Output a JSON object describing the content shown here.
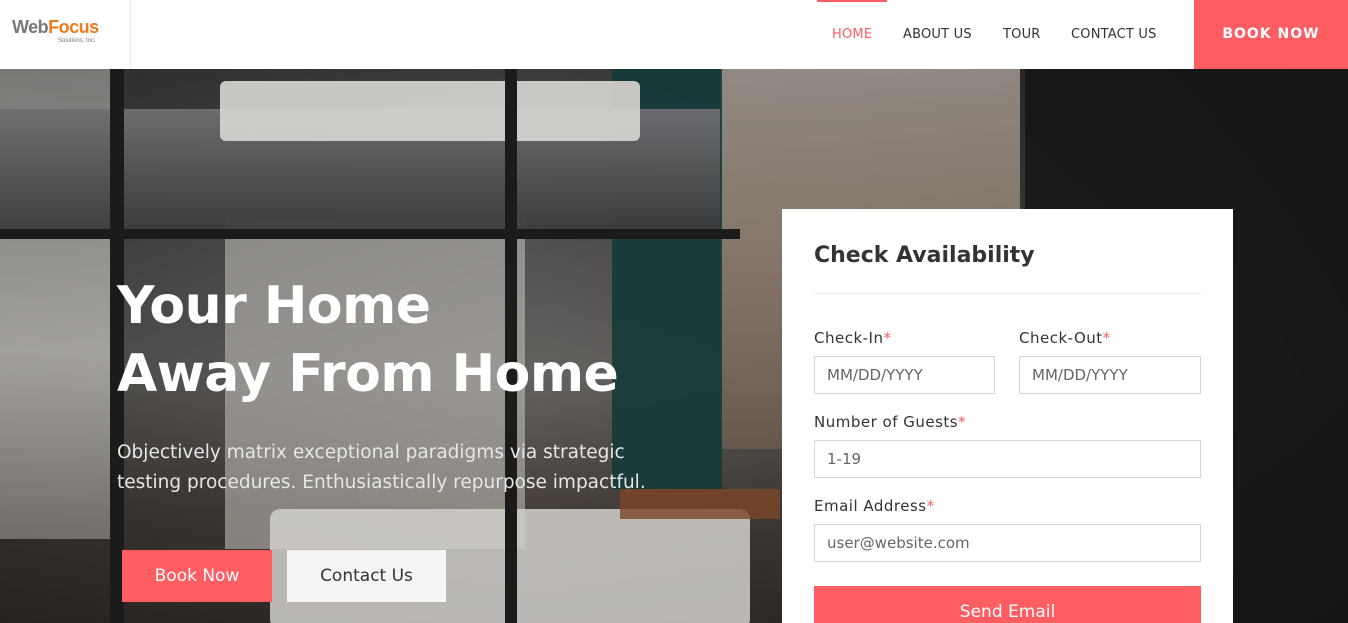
{
  "brand": {
    "logo_primary_1": "Web",
    "logo_primary_2": "Focus",
    "logo_sub": "Solutions, Inc."
  },
  "nav": {
    "items": [
      {
        "label": "HOME",
        "active": true
      },
      {
        "label": "ABOUT US",
        "active": false
      },
      {
        "label": "TOUR",
        "active": false
      },
      {
        "label": "CONTACT US",
        "active": false
      }
    ],
    "cta_label": "BOOK NOW"
  },
  "hero": {
    "title_line1": "Your Home",
    "title_line2": "Away From Home",
    "description": "Objectively matrix exceptional paradigms via strategic testing procedures. Enthusiastically repurpose impactful.",
    "primary_button": "Book Now",
    "secondary_button": "Contact Us"
  },
  "form": {
    "title": "Check Availability",
    "checkin": {
      "label": "Check-In",
      "required_mark": "*",
      "placeholder": "MM/DD/YYYY"
    },
    "checkout": {
      "label": "Check-Out",
      "required_mark": "*",
      "placeholder": "MM/DD/YYYY"
    },
    "guests": {
      "label": "Number of Guests",
      "required_mark": "*",
      "placeholder": "1-19"
    },
    "email": {
      "label": "Email Address",
      "required_mark": "*",
      "placeholder": "user@website.com"
    },
    "submit_label": "Send Email"
  },
  "colors": {
    "accent": "#fe5d61",
    "logo_orange": "#f07b1c",
    "text_dark": "#333333"
  }
}
